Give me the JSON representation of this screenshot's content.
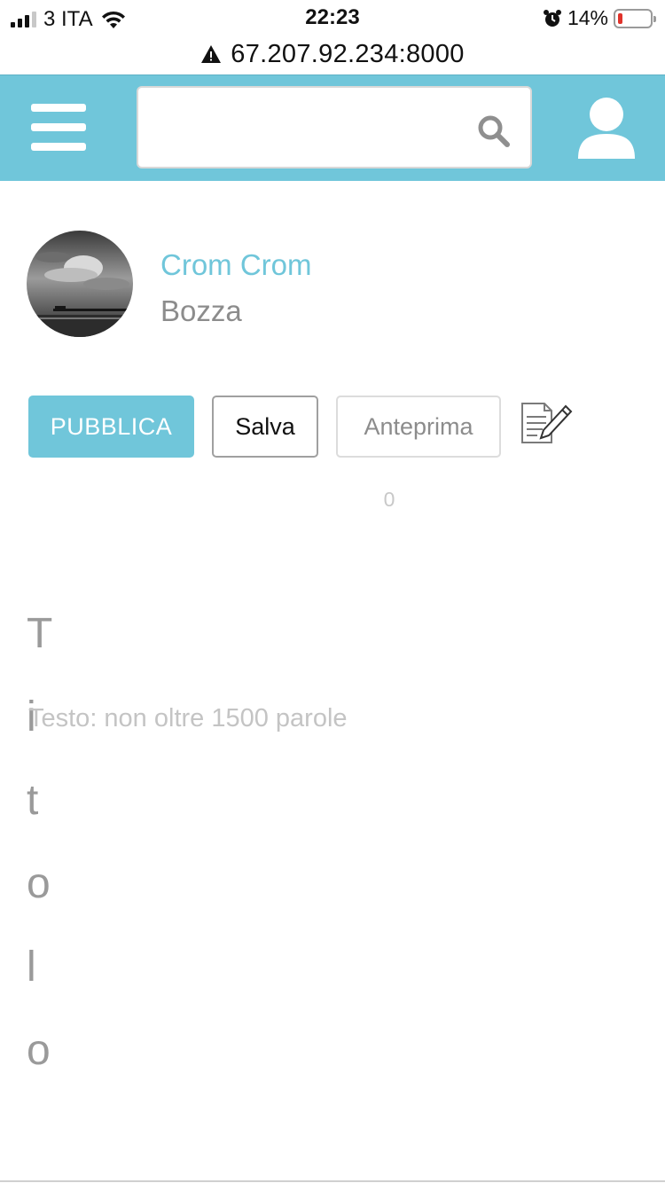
{
  "status_bar": {
    "carrier": "3 ITA",
    "time": "22:23",
    "battery_percent": "14%",
    "battery_level": 0.14
  },
  "browser": {
    "url": "67.207.92.234:8000"
  },
  "header": {
    "search_value": "",
    "accent_color": "#70c6da"
  },
  "profile": {
    "author_name": "Crom Crom",
    "status": "Bozza"
  },
  "actions": {
    "publish_label": "PUBBLICA",
    "save_label": "Salva",
    "preview_label": "Anteprima"
  },
  "editor": {
    "word_count": "0",
    "title_placeholder": "Titolo",
    "body_placeholder": "Testo: non oltre 1500 parole"
  }
}
